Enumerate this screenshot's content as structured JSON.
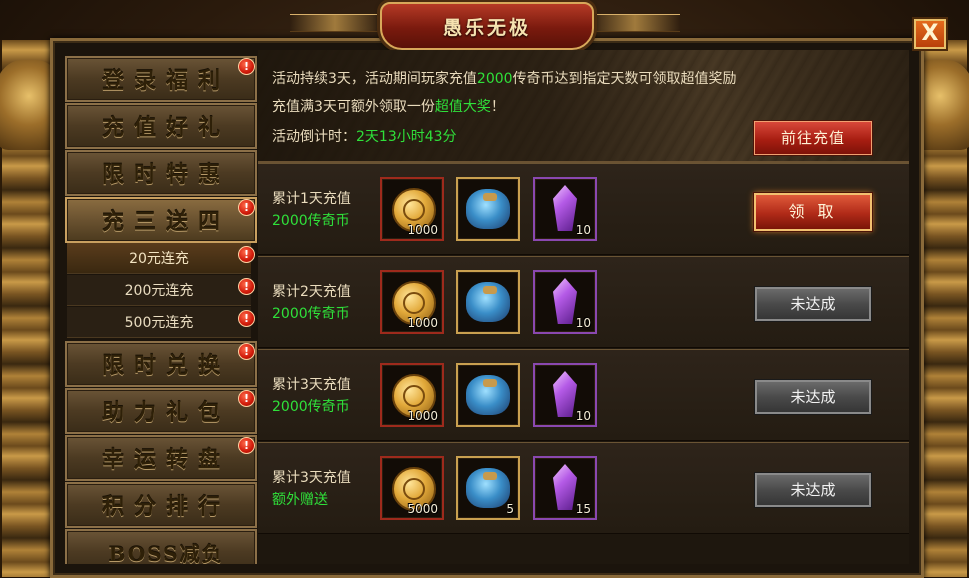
{
  "window": {
    "title": "愚乐无极"
  },
  "sidebar": {
    "items": [
      {
        "label": "登录福利",
        "badge": "!"
      },
      {
        "label": "充值好礼",
        "badge": ""
      },
      {
        "label": "限时特惠",
        "badge": ""
      },
      {
        "label": "充三送四",
        "badge": "!",
        "active": true
      },
      {
        "label": "限时兑换",
        "badge": "!"
      },
      {
        "label": "助力礼包",
        "badge": "!"
      },
      {
        "label": "幸运转盘",
        "badge": "!"
      },
      {
        "label": "积分排行",
        "badge": ""
      },
      {
        "label": "BOSS减负",
        "badge": ""
      }
    ],
    "subitems": [
      {
        "label": "20元连充",
        "badge": "!"
      },
      {
        "label": "200元连充",
        "badge": "!"
      },
      {
        "label": "500元连充",
        "badge": "!"
      }
    ]
  },
  "banner": {
    "line1_pre": "活动持续3天，活动期间玩家充值",
    "line1_amount": "2000",
    "line1_post": "传奇币达到指定天数可领取超值奖励",
    "line2_pre": "充值满3天可额外领取一份",
    "line2_highlight": "超值大奖",
    "line2_post": "！",
    "countdown_label": "活动倒计时：",
    "countdown_value": "2天13小时43分",
    "recharge_button": "前往充值"
  },
  "rewards": [
    {
      "condition": "累计1天充值",
      "amount": "2000传奇币",
      "items": [
        {
          "icon": "gold-coin-icon",
          "count": "1000"
        },
        {
          "icon": "treasure-bag-icon",
          "count": ""
        },
        {
          "icon": "purple-crystal-icon",
          "count": "10"
        }
      ],
      "button": "领 取",
      "status": "claimable"
    },
    {
      "condition": "累计2天充值",
      "amount": "2000传奇币",
      "items": [
        {
          "icon": "gold-coin-icon",
          "count": "1000"
        },
        {
          "icon": "treasure-bag-icon",
          "count": ""
        },
        {
          "icon": "purple-crystal-icon",
          "count": "10"
        }
      ],
      "button": "未达成",
      "status": "locked"
    },
    {
      "condition": "累计3天充值",
      "amount": "2000传奇币",
      "items": [
        {
          "icon": "gold-coin-icon",
          "count": "1000"
        },
        {
          "icon": "treasure-bag-icon",
          "count": ""
        },
        {
          "icon": "purple-crystal-icon",
          "count": "10"
        }
      ],
      "button": "未达成",
      "status": "locked"
    },
    {
      "condition": "累计3天充值",
      "amount": "额外赠送",
      "items": [
        {
          "icon": "gold-coin-icon",
          "count": "5000"
        },
        {
          "icon": "treasure-bag-icon",
          "count": "5"
        },
        {
          "icon": "purple-crystal-icon",
          "count": "15"
        }
      ],
      "button": "未达成",
      "status": "locked"
    }
  ],
  "close": {
    "label": "X"
  },
  "colors": {
    "highlight_green": "#2fe03a",
    "claim_red": "#b02a18",
    "locked_gray": "#4a4a4a",
    "title_red": "#7a1a0e"
  }
}
